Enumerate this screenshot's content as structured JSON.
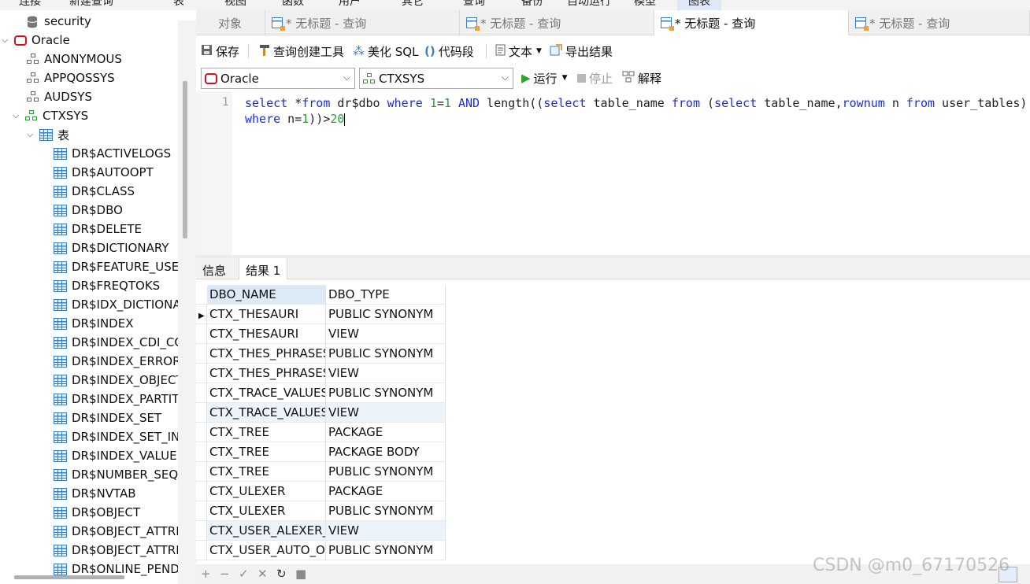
{
  "menubar": {
    "items": [
      "连接",
      "新建查询",
      "表",
      "视图",
      "函数",
      "用户",
      "其它",
      "查询",
      "备份",
      "自动运行",
      "模型",
      "图表"
    ]
  },
  "tree": {
    "items": [
      {
        "label": "security",
        "type": "db"
      },
      {
        "label": "Oracle",
        "type": "connection"
      },
      {
        "label": "ANONYMOUS",
        "type": "schema"
      },
      {
        "label": "APPQOSSYS",
        "type": "schema"
      },
      {
        "label": "AUDSYS",
        "type": "schema"
      },
      {
        "label": "CTXSYS",
        "type": "schema-open"
      },
      {
        "label": "表",
        "type": "tables-folder"
      }
    ],
    "tables": [
      "DR$ACTIVELOGS",
      "DR$AUTOOPT",
      "DR$CLASS",
      "DR$DBO",
      "DR$DELETE",
      "DR$DICTIONARY",
      "DR$FEATURE_USED",
      "DR$FREQTOKS",
      "DR$IDX_DICTIONA",
      "DR$INDEX",
      "DR$INDEX_CDI_CO",
      "DR$INDEX_ERROR",
      "DR$INDEX_OBJECT",
      "DR$INDEX_PARTIT",
      "DR$INDEX_SET",
      "DR$INDEX_SET_INI",
      "DR$INDEX_VALUE",
      "DR$NUMBER_SEQU",
      "DR$NVTAB",
      "DR$OBJECT",
      "DR$OBJECT_ATTRI",
      "DR$OBJECT_ATTRI",
      "DR$ONLINE_PEND"
    ]
  },
  "tabs": [
    "对象",
    "* 无标题 - 查询",
    "* 无标题 - 查询",
    "* 无标题 - 查询",
    "* 无标题 - 查询"
  ],
  "toolbar": {
    "save": "保存",
    "query_builder": "查询创建工具",
    "beautify": "美化 SQL",
    "snippet": "代码段",
    "text": "文本",
    "export": "导出结果"
  },
  "conn": {
    "connection": "Oracle",
    "schema": "CTXSYS",
    "run": "运行",
    "stop": "停止",
    "explain": "解释"
  },
  "editor": {
    "line_number": "1"
  },
  "result_tabs": {
    "info": "信息",
    "result": "结果 1"
  },
  "grid": {
    "columns": [
      "DBO_NAME",
      "DBO_TYPE"
    ],
    "rows": [
      [
        "CTX_THESAURI",
        "PUBLIC SYNONYM"
      ],
      [
        "CTX_THESAURI",
        "VIEW"
      ],
      [
        "CTX_THES_PHRASES",
        "PUBLIC SYNONYM"
      ],
      [
        "CTX_THES_PHRASES",
        "VIEW"
      ],
      [
        "CTX_TRACE_VALUES",
        "PUBLIC SYNONYM"
      ],
      [
        "CTX_TRACE_VALUES",
        "VIEW"
      ],
      [
        "CTX_TREE",
        "PACKAGE"
      ],
      [
        "CTX_TREE",
        "PACKAGE BODY"
      ],
      [
        "CTX_TREE",
        "PUBLIC SYNONYM"
      ],
      [
        "CTX_ULEXER",
        "PACKAGE"
      ],
      [
        "CTX_ULEXER",
        "PUBLIC SYNONYM"
      ],
      [
        "CTX_USER_ALEXER_D",
        "VIEW"
      ],
      [
        "CTX_USER_AUTO_OPT",
        "PUBLIC SYNONYM"
      ]
    ]
  },
  "statusbar": {
    "watermark": "CSDN @m0_67170526"
  },
  "colors": {
    "accent": "#3d7fc4",
    "keyword": "#1c2ddc",
    "number": "#25a03a",
    "oracle": "#d0121e",
    "schema": "#2e9a3a"
  }
}
